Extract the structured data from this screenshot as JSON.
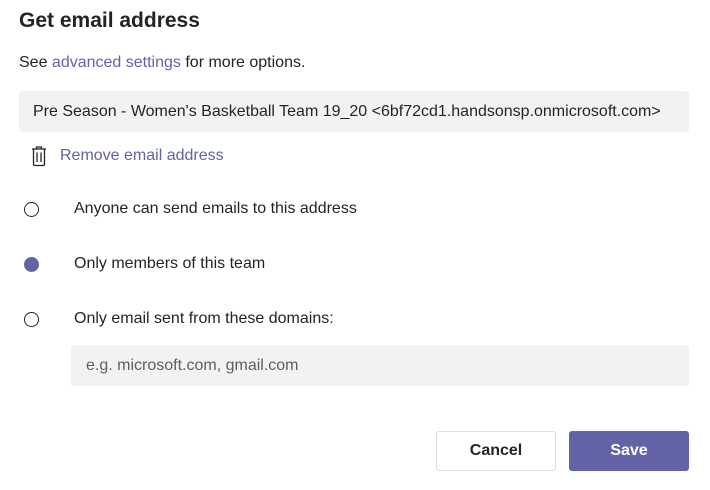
{
  "dialog": {
    "title": "Get email address",
    "subtitle": {
      "prefix": "See ",
      "link": "advanced settings",
      "suffix": " for more options."
    },
    "email_address": "Pre Season - Women's Basketball Team 19_20 <6bf72cd1.handsonsp.onmicrosoft.com>",
    "remove_label": "Remove email address",
    "remove_icon": "trash-icon",
    "options": [
      {
        "label": "Anyone can send emails to this address",
        "selected": false
      },
      {
        "label": "Only members of this team",
        "selected": true
      },
      {
        "label": "Only email sent from these domains:",
        "selected": false
      }
    ],
    "domains_placeholder": "e.g. microsoft.com, gmail.com",
    "domains_value": "",
    "cancel_label": "Cancel",
    "save_label": "Save"
  },
  "colors": {
    "accent": "#6264a7",
    "field_bg": "#f3f2f1",
    "text": "#252423"
  }
}
